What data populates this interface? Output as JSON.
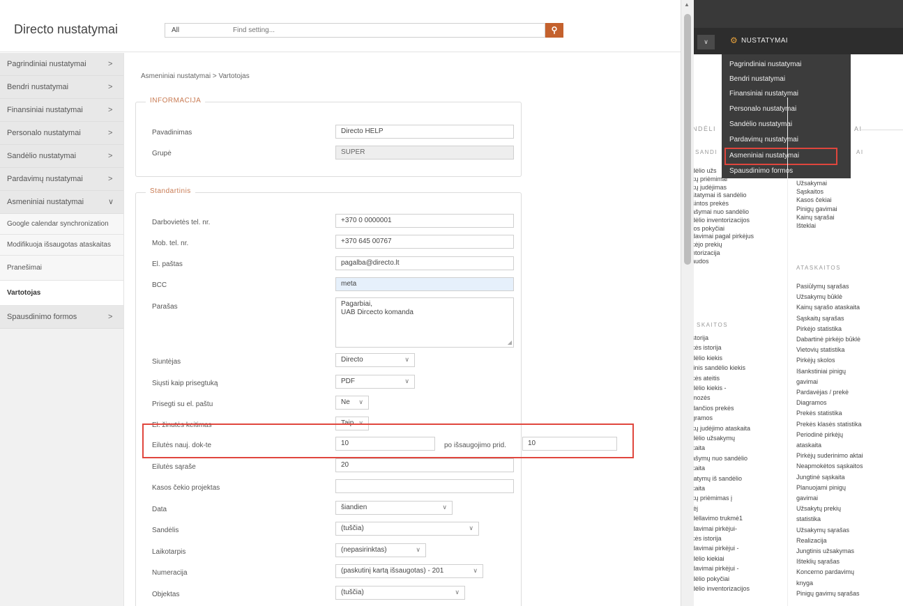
{
  "left": {
    "title": "Directo nustatymai",
    "category_select": "All",
    "search_placeholder": "Find setting...",
    "breadcrumb": "Asmeniniai nustatymai > Vartotojas",
    "sidebar": {
      "items": [
        {
          "label": "Pagrindiniai nustatymai",
          "arrow": ">"
        },
        {
          "label": "Bendri nustatymai",
          "arrow": ">"
        },
        {
          "label": "Finansiniai nustatymai",
          "arrow": ">"
        },
        {
          "label": "Personalo nustatymai",
          "arrow": ">"
        },
        {
          "label": "Sandėlio nustatymai",
          "arrow": ">"
        },
        {
          "label": "Pardavimų nustatymai",
          "arrow": ">"
        },
        {
          "label": "Asmeniniai nustatymai",
          "arrow": "∨"
        }
      ],
      "sub_items": [
        "Google calendar synchronization",
        "Modifikuoja išsaugotas ataskaitas",
        "Pranešimai",
        "Vartotojas"
      ],
      "last_item": {
        "label": "Spausdinimo formos",
        "arrow": ">"
      }
    },
    "informacija": {
      "legend": "INFORMACIJA",
      "pavadinimas_label": "Pavadinimas",
      "pavadinimas_value": "Directo HELP",
      "grupe_label": "Grupė",
      "grupe_value": "SUPER"
    },
    "standartinis": {
      "legend": "Standartinis",
      "fields": {
        "darbovietes_label": "Darbovietės tel. nr.",
        "darbovietes_value": "+370 0 0000001",
        "mob_label": "Mob. tel. nr.",
        "mob_value": "+370 645 00767",
        "email_label": "El. paštas",
        "email_value": "pagalba@directo.lt",
        "bcc_label": "BCC",
        "bcc_value": "meta",
        "parasas_label": "Parašas",
        "parasas_line1": "Pagarbiai,",
        "parasas_line2": "UAB Dircecto komanda",
        "siuntejas_label": "Siuntėjas",
        "siuntejas_value": "Directo",
        "siusti_label": "Siųsti kaip prisegtuką",
        "siusti_value": "PDF",
        "prisegti_label": "Prisegti su el. paštu",
        "prisegti_value": "Ne",
        "zinutes_label": "El. žinutės keitimas",
        "zinutes_value": "Taip",
        "eilutes_label": "Eilutės nauj. dok-te",
        "eilutes_value": "10",
        "po_label": "po išsaugojimo prid.",
        "po_value": "10",
        "eilutes_sar_label": "Eilutės sąraše",
        "eilutes_sar_value": "20",
        "kasos_label": "Kasos čekio projektas",
        "kasos_value": "",
        "data_label": "Data",
        "data_value": "šiandien",
        "sandelis_label": "Sandėlis",
        "sandelis_value": "(tuščia)",
        "laikotarpis_label": "Laikotarpis",
        "laikotarpis_value": "(nepasirinktas)",
        "numeracija_label": "Numeracija",
        "numeracija_value": "(paskutinį kartą išsaugotas) - 201",
        "objektas_label": "Objektas",
        "objektas_value": "(tuščia)"
      }
    }
  },
  "right": {
    "nav_label": "NUSTATYMAI",
    "dropdown": [
      "Pagrindiniai nustatymai",
      "Bendri nustatymai",
      "Finansiniai nustatymai",
      "Personalo nustatymai",
      "Sandėlio nustatymai",
      "Pardavimų nustatymai",
      "Asmeniniai nustatymai",
      "Spausdinimo formos"
    ],
    "col1_top": [
      "NDĖLI",
      "SANDI"
    ],
    "col1_links": [
      "dėlio užs",
      "kų priėmimai",
      "kų judėjimas",
      "štatymai iš sandėlio",
      "šintos prekės",
      "ašymai nuo sandėlio",
      "dėlio inventorizacijos",
      "tos pokyčiai",
      "davimai pagal pirkėjus",
      "kėjo prekių",
      "ntorizacija",
      "audos"
    ],
    "col1_head2": "SKAITOS",
    "col1_links2": [
      "storija",
      "kės istorija",
      "dėlio kiekis",
      "tinis sandėlio kiekis",
      "kės ateitis",
      "dėlio kiekis -",
      "mozės",
      "dančios prekės",
      "gramos",
      "kų judėjimo ataskaita",
      "dėlio užsakymų",
      "kaita",
      "ašymų nuo sandėlio",
      "kaita",
      "tatymų iš sandėlio",
      "kaita",
      "kų priėmimas į",
      "lėj",
      "dėllavimo trukmė1",
      "davimai pirkėjui-",
      "kės istorija",
      "davimai pirkėjui -",
      "dėlio kiekiai",
      "davimai pirkėjui -",
      "dėlio pokyčiai",
      "dėlio inventorizacijos"
    ],
    "col2_top": [
      "AI",
      "AI"
    ],
    "col2_links": [
      "Užsakymai",
      "Sąskaitos",
      "Kasos čekiai",
      "Pinigų gavimai",
      "Kainų sąrašai",
      "Išteklai"
    ],
    "col2_head2": "ATASKAITOS",
    "col2_links2": [
      "Pasiūlymų sąrašas",
      "Užsakymų būklė",
      "Kainų sąrašo ataskaita",
      "Sąskaitų sąrašas",
      "Pirkėjo statistika",
      "Dabartinė pirkėjo būklė",
      "Vietovių statistika",
      "Pirkėjų skolos",
      "Išankstiniai pinigų",
      "gavimai",
      "Pardavėjas / prekė",
      "Diagramos",
      "Prekės statistika",
      "Prekės klasės statistika",
      "Periodinė pirkėjų",
      "ataskaita",
      "Pirkėjų suderinimo aktai",
      "Neapmokėtos sąskaitos",
      "Jungtinė sąskaita",
      "Planuojami pinigų",
      "gavimai",
      "Užsakytų prekių",
      "statistika",
      "Užsakymų sąrašas",
      "Realizacija",
      "Jungtinis užsakymas",
      "Išteklių sąrašas",
      "Koncerno pardavimų",
      "knyga",
      "Pinigų gavimų sąrašas"
    ]
  }
}
